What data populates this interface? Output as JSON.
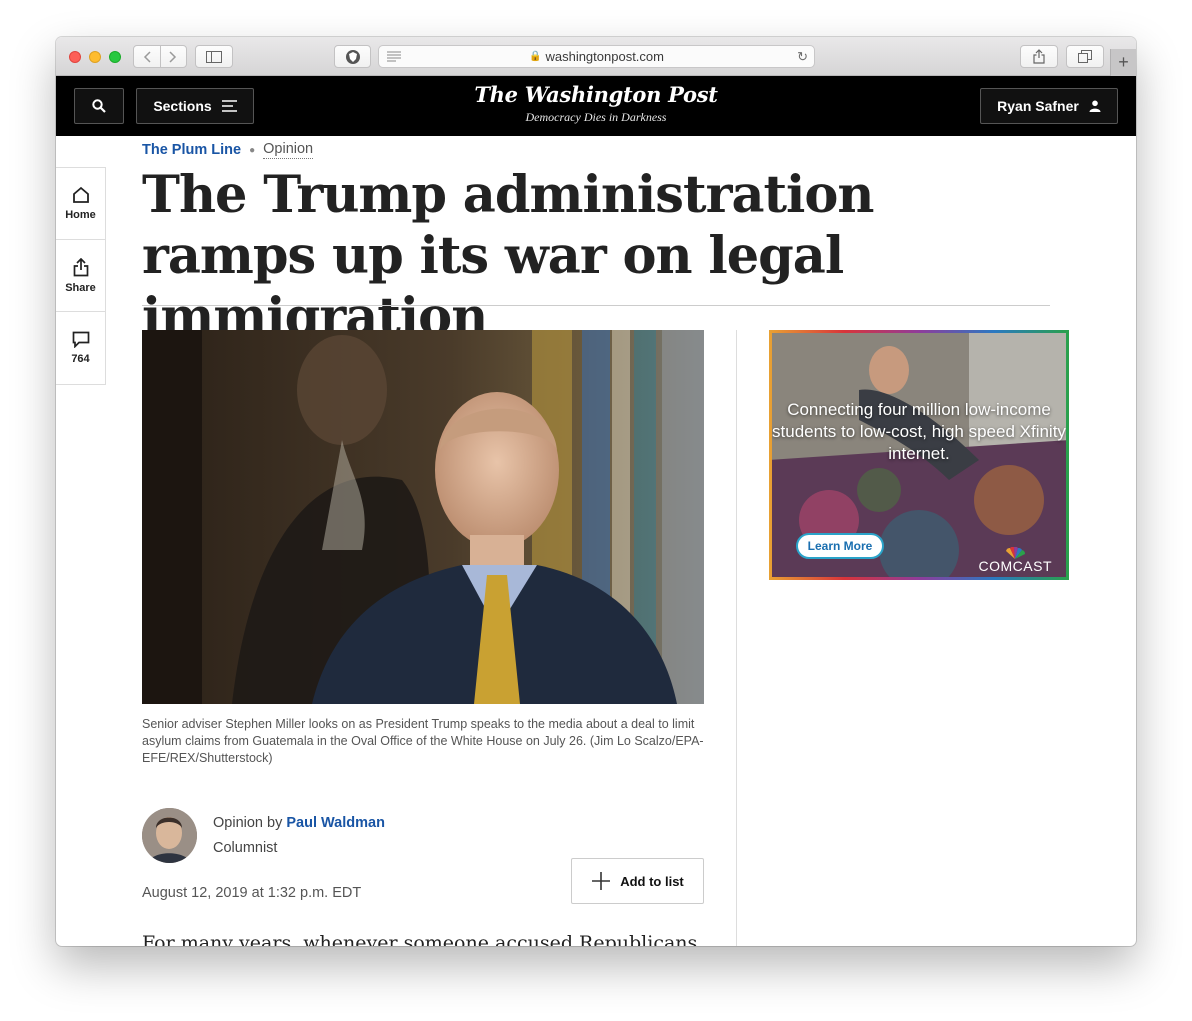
{
  "browser": {
    "url": "washingtonpost.com"
  },
  "header": {
    "sections_label": "Sections",
    "logo": "The Washington Post",
    "tagline": "Democracy Dies in Darkness",
    "user_label": "Ryan Safner"
  },
  "rail": {
    "home_label": "Home",
    "share_label": "Share",
    "comments_count": "764"
  },
  "article": {
    "kicker_blog": "The Plum Line",
    "kicker_section": "Opinion",
    "headline": "The Trump administration ramps up its war on legal immigration",
    "caption": "Senior adviser Stephen Miller looks on as President Trump speaks to the media about a deal to limit asylum claims from Guatemala in the Oval Office of the White House on July 26. (Jim Lo Scalzo/EPA-EFE/REX/Shutterstock)",
    "byline_prefix": "Opinion by",
    "author": "Paul Waldman",
    "author_role": "Columnist",
    "date": "August 12, 2019 at 1:32 p.m. EDT",
    "add_to_list": "Add to list",
    "first_line": "For many years, whenever someone accused Republicans of"
  },
  "ad": {
    "text": "Connecting four million low-income students to low-cost, high speed Xfinity internet.",
    "button": "Learn More",
    "brand": "COMCAST"
  }
}
